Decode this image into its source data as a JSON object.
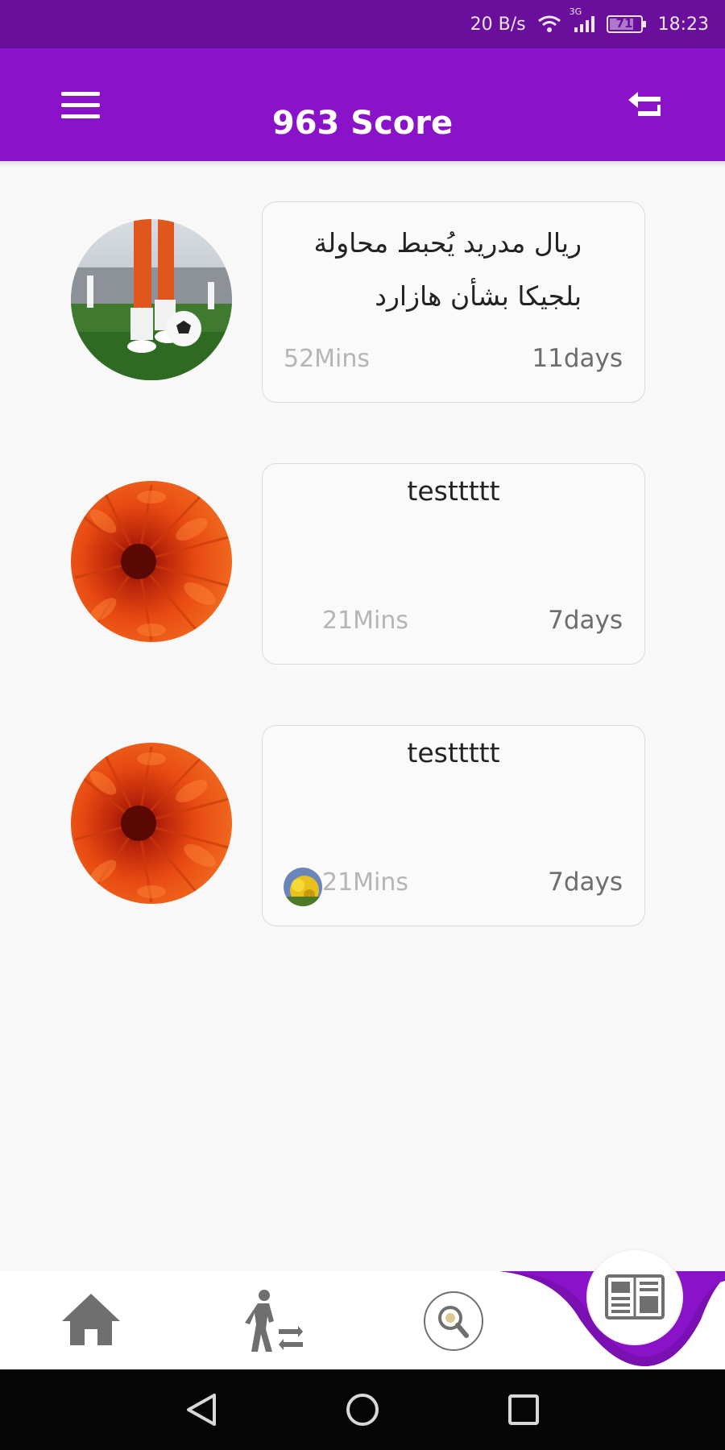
{
  "status_bar": {
    "speed": "20 B/s",
    "network": "3G",
    "battery": "71",
    "time": "18:23"
  },
  "app_bar": {
    "title": "963 Score"
  },
  "news": [
    {
      "title": "ريال مدريد يُحبط محاولة بلجيكا بشأن هازارد",
      "duration": "52Mins",
      "time_ago": "11days",
      "image": "soccer-player-photo"
    },
    {
      "title": "testtttt",
      "duration": "21Mins",
      "time_ago": "7days",
      "image": "orange-flower-photo"
    },
    {
      "title": "testtttt",
      "duration": "21Mins",
      "time_ago": "7days",
      "image": "orange-flower-photo"
    }
  ],
  "bottom_nav": {
    "items": [
      "home-icon",
      "transfers-icon",
      "search-icon",
      "news-icon"
    ],
    "active": "news-icon"
  },
  "colors": {
    "status_bar": "#6a0f9c",
    "app_bar": "#8a12c9",
    "accent": "#8a12c9",
    "background": "#f8f8f8"
  }
}
